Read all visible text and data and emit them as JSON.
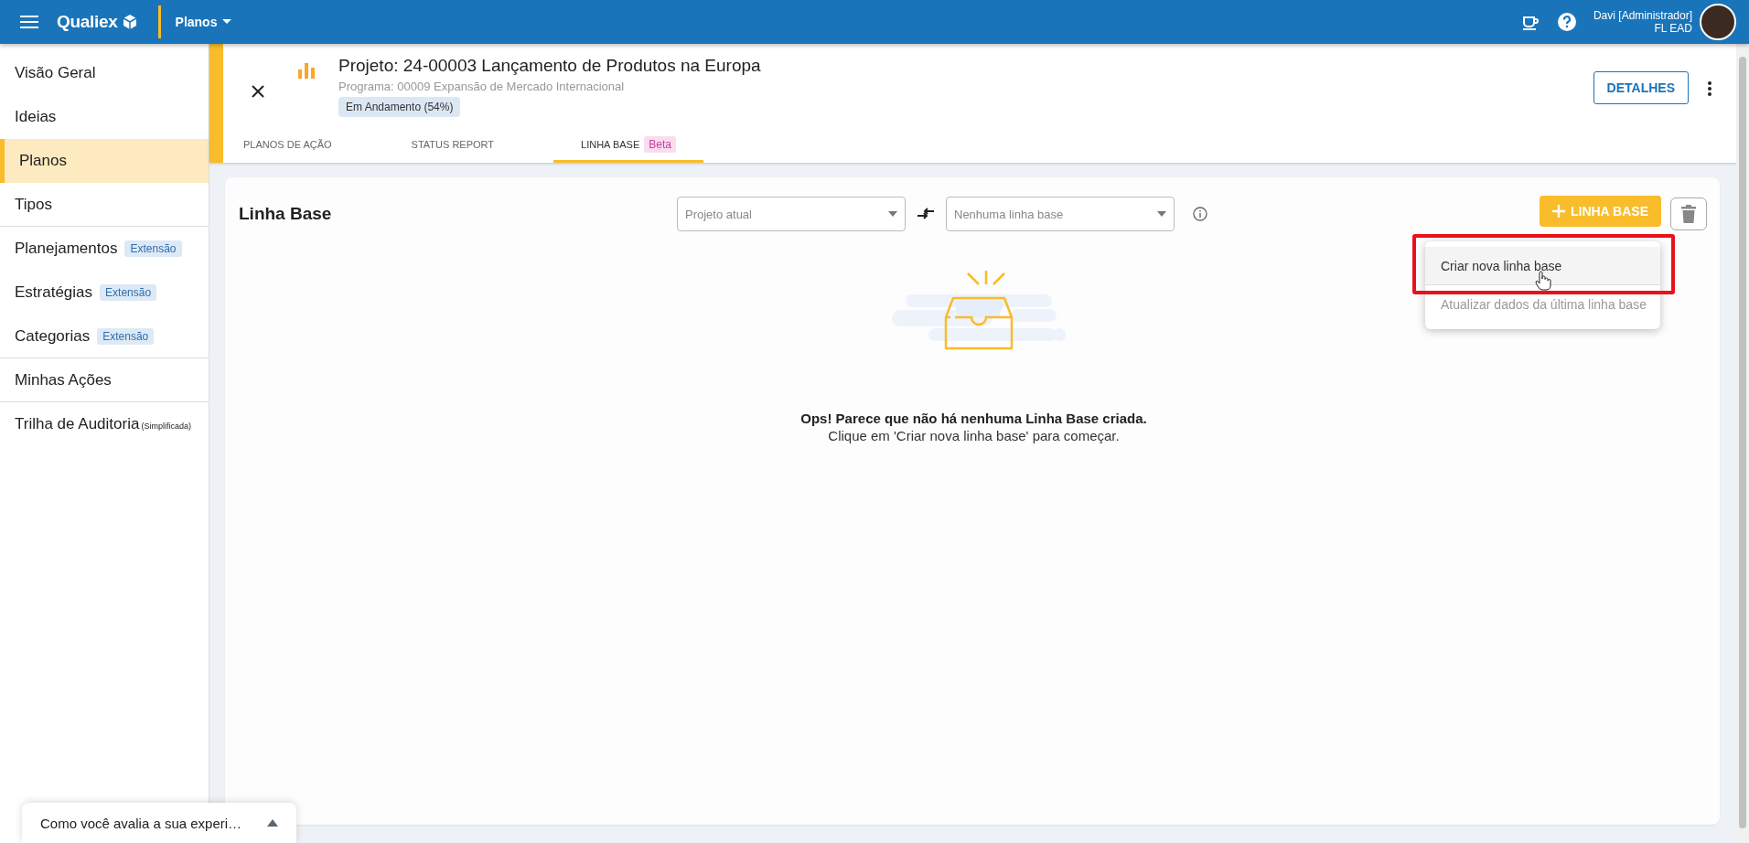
{
  "top_bar": {
    "logo": "Qualiex",
    "module": "Planos",
    "user_name": "Davi [Administrador]",
    "user_unit": "FL EAD"
  },
  "sidebar": {
    "items": [
      {
        "label": "Visão Geral",
        "selected": false
      },
      {
        "label": "Ideias",
        "selected": false
      },
      {
        "label": "Planos",
        "selected": true
      },
      {
        "label": "Tipos",
        "selected": false,
        "divider_after": true
      },
      {
        "label": "Planejamentos",
        "badge": "Extensão",
        "selected": false
      },
      {
        "label": "Estratégias",
        "badge": "Extensão",
        "selected": false
      },
      {
        "label": "Categorias",
        "badge": "Extensão",
        "selected": false,
        "divider_after": true
      },
      {
        "label": "Minhas Ações",
        "selected": false,
        "divider_after": true
      },
      {
        "label": "Trilha de Auditoria",
        "note": "(Simplificada)",
        "selected": false
      }
    ]
  },
  "header": {
    "title": "Projeto: 24-00003 Lançamento de Produtos na Europa",
    "subtitle": "Programa: 00009 Expansão de Mercado Internacional",
    "status": "Em Andamento (54%)",
    "details_button": "DETALHES",
    "tabs": [
      {
        "label": "PLANOS DE AÇÃO",
        "selected": false
      },
      {
        "label": "STATUS REPORT",
        "selected": false
      },
      {
        "label": "LINHA BASE",
        "badge": "Beta",
        "selected": true
      }
    ]
  },
  "baseline": {
    "title": "Linha Base",
    "left_select": {
      "placeholder": "Projeto atual"
    },
    "right_select": {
      "placeholder": "Nenhuma linha base"
    },
    "add_button": "LINHA BASE",
    "menu": [
      {
        "label": "Criar nova linha base",
        "disabled": false,
        "highlighted": true
      },
      {
        "label": "Atualizar dados da última linha base",
        "disabled": true,
        "highlighted": false
      }
    ],
    "empty_title": "Ops! Parece que não há nenhuma Linha Base criada.",
    "empty_hint": "Clique em 'Criar nova linha base' para começar."
  },
  "feedback": {
    "label": "Como você avalia a sua experi…"
  }
}
